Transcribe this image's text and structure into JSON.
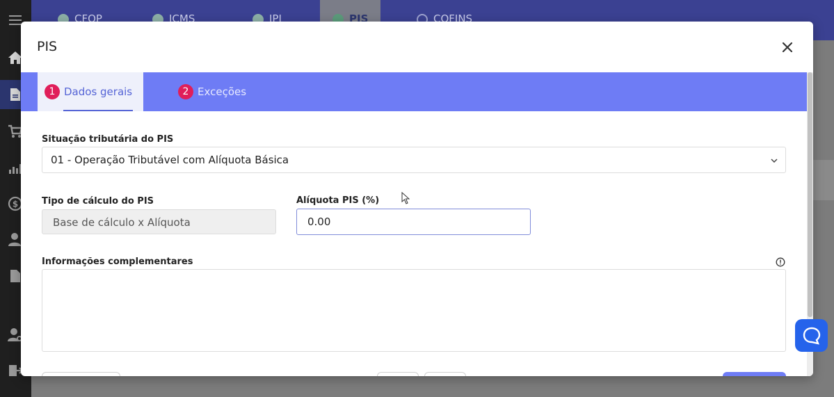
{
  "background": {
    "tabs": [
      {
        "label": "CFOP",
        "state": "done"
      },
      {
        "label": "ICMS",
        "state": "done"
      },
      {
        "label": "IPI",
        "state": "done"
      },
      {
        "label": "PIS",
        "state": "active"
      },
      {
        "label": "COFINS",
        "state": "pending"
      }
    ]
  },
  "modal": {
    "title": "PIS",
    "tabs": [
      {
        "number": "1",
        "label": "Dados gerais"
      },
      {
        "number": "2",
        "label": "Exceções"
      }
    ],
    "fields": {
      "situacao": {
        "label": "Situação tributária do PIS",
        "value": "01 - Operação Tributável com Alíquota Básica"
      },
      "tipo_calculo": {
        "label": "Tipo de cálculo do PIS",
        "value": "Base de cálculo x Alíquota"
      },
      "aliquota": {
        "label": "Alíquota PIS (%)",
        "value": "0.00"
      },
      "informacoes": {
        "label": "Informações complementares",
        "value": ""
      }
    }
  },
  "colors": {
    "accent": "#6e7cf5",
    "badge": "#e01e5a",
    "chat": "#2563eb"
  }
}
